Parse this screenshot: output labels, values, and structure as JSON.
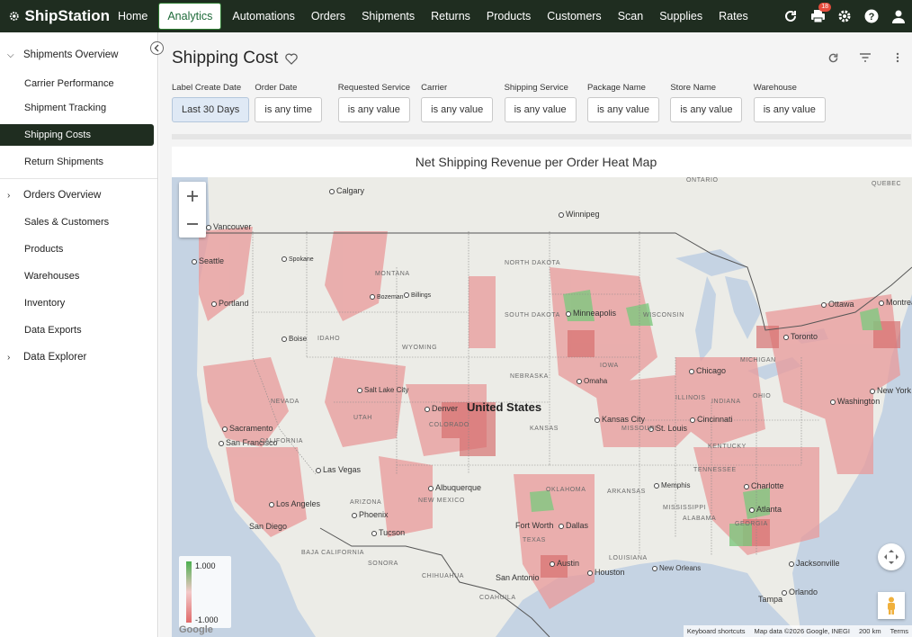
{
  "app": {
    "name": "ShipStation"
  },
  "nav": {
    "items": [
      {
        "label": "Home"
      },
      {
        "label": "Analytics"
      },
      {
        "label": "Automations"
      },
      {
        "label": "Orders"
      },
      {
        "label": "Shipments"
      },
      {
        "label": "Returns"
      },
      {
        "label": "Products"
      },
      {
        "label": "Customers"
      },
      {
        "label": "Scan"
      },
      {
        "label": "Supplies"
      },
      {
        "label": "Rates"
      }
    ],
    "active": "Analytics",
    "printer_badge": "18"
  },
  "sidebar": {
    "shipments_overview": "Shipments Overview",
    "shipments_items": [
      "Carrier Performance",
      "Shipment Tracking",
      "Shipping Costs",
      "Return Shipments"
    ],
    "orders_overview": "Orders Overview",
    "other_items": [
      "Sales & Customers",
      "Products",
      "Warehouses",
      "Inventory",
      "Data Exports"
    ],
    "data_explorer": "Data Explorer"
  },
  "page": {
    "title": "Shipping Cost"
  },
  "filters": [
    {
      "label": "Label Create Date",
      "value": "Last 30 Days"
    },
    {
      "label": "Order Date",
      "value": "is any time"
    },
    {
      "label": "Requested Service",
      "value": "is any value"
    },
    {
      "label": "Carrier",
      "value": "is any value"
    },
    {
      "label": "Shipping Service",
      "value": "is any value"
    },
    {
      "label": "Package Name",
      "value": "is any value"
    },
    {
      "label": "Store Name",
      "value": "is any value"
    },
    {
      "label": "Warehouse",
      "value": "is any value"
    }
  ],
  "map": {
    "title": "Net Shipping Revenue per Order Heat Map",
    "legend_max": "1.000",
    "legend_min": "-1.000",
    "country": "United States",
    "cities": [
      "Calgary",
      "Winnipeg",
      "Vancouver",
      "Seattle",
      "Spokane",
      "Bozeman",
      "Billings",
      "Portland",
      "Boise",
      "Minneapolis",
      "Ottawa",
      "Montreal",
      "Toronto",
      "Chicago",
      "Salt Lake City",
      "Denver",
      "Omaha",
      "Sacramento",
      "San Francisco",
      "Kansas City",
      "St. Louis",
      "Cincinnati",
      "Washington",
      "New York",
      "Las Vegas",
      "Los Angeles",
      "Albuquerque",
      "Phoenix",
      "Memphis",
      "Charlotte",
      "San Diego",
      "Tucson",
      "Fort Worth",
      "Dallas",
      "Atlanta",
      "Austin",
      "Houston",
      "San Antonio",
      "New Orleans",
      "Jacksonville",
      "Tampa",
      "Orlando"
    ],
    "states": [
      "MONTANA",
      "NORTH DAKOTA",
      "SOUTH DAKOTA",
      "WYOMING",
      "IDAHO",
      "NEBRASKA",
      "UTAH",
      "COLORADO",
      "KANSAS",
      "NEVADA",
      "CALIFORNIA",
      "ARIZONA",
      "NEW MEXICO",
      "OKLAHOMA",
      "TEXAS",
      "ARKANSAS",
      "MISSISSIPPI",
      "ALABAMA",
      "GEORGIA",
      "LOUISIANA",
      "MISSOURI",
      "IOWA",
      "WISCONSIN",
      "ILLINOIS",
      "INDIANA",
      "OHIO",
      "KENTUCKY",
      "TENNESSEE",
      "MICHIGAN",
      "BAJA CALIFORNIA",
      "SONORA",
      "CHIHUAHUA",
      "COAHUILA",
      "ONTARIO",
      "QUEBEC"
    ],
    "attribution": [
      "Keyboard shortcuts",
      "Map data ©2026 Google, INEGI",
      "200 km",
      "Terms"
    ],
    "colors": {
      "positive": "#4caf50",
      "neutral": "#f3c9c9",
      "negative": "#e06a6a"
    }
  }
}
